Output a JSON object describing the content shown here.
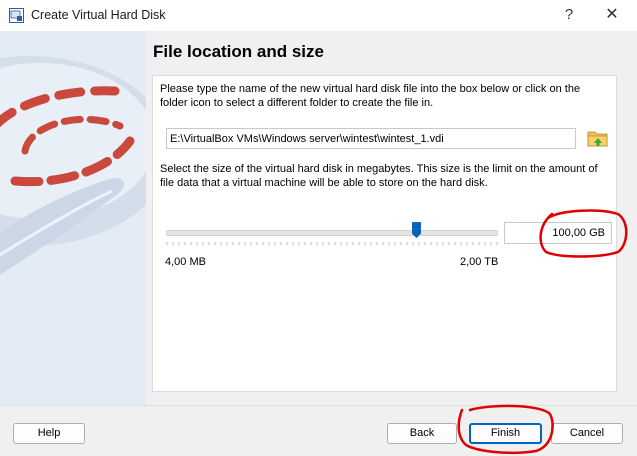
{
  "window": {
    "title": "Create Virtual Hard Disk",
    "help_glyph": "?",
    "close_glyph": "✕"
  },
  "page": {
    "title": "File location and size",
    "location_description": "Please type the name of the new virtual hard disk file into the box below or click on the folder icon to select a different folder to create the file in.",
    "file_path": "E:\\VirtualBox VMs\\Windows server\\wintest\\wintest_1.vdi",
    "size_description": "Select the size of the virtual hard disk in megabytes. This size is the limit on the amount of file data that a virtual machine will be able to store on the hard disk.",
    "size_value": "100,00 GB",
    "slider": {
      "min_label": "4,00 MB",
      "max_label": "2,00 TB",
      "position_fraction": 0.76
    }
  },
  "buttons": {
    "help": "Help",
    "back": "Back",
    "finish": "Finish",
    "cancel": "Cancel"
  },
  "icons": {
    "app": "virtualbox-app-icon",
    "folder": "folder-open-icon"
  },
  "colors": {
    "accent": "#0067c0",
    "annotation": "#e00000",
    "art_red": "#c94a3c",
    "art_blue": "#d3deea"
  }
}
